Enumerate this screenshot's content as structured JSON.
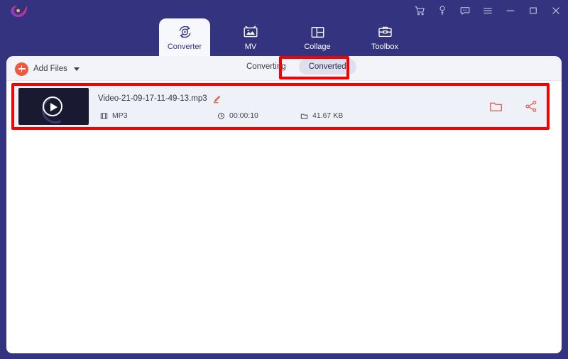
{
  "window": {
    "logo_name": "video-converter-logo",
    "background_color": "#343380",
    "controls": [
      {
        "name": "cart-icon",
        "label": "Cart"
      },
      {
        "name": "key-icon",
        "label": "Register"
      },
      {
        "name": "feedback-icon",
        "label": "Feedback"
      },
      {
        "name": "menu-icon",
        "label": "Menu"
      },
      {
        "name": "minimize-icon",
        "label": "Minimize"
      },
      {
        "name": "maximize-icon",
        "label": "Maximize"
      },
      {
        "name": "close-icon",
        "label": "Close"
      }
    ]
  },
  "tabs": [
    {
      "id": "converter",
      "label": "Converter",
      "icon": "converter-icon",
      "active": true
    },
    {
      "id": "mv",
      "label": "MV",
      "icon": "mv-icon",
      "active": false
    },
    {
      "id": "collage",
      "label": "Collage",
      "icon": "collage-icon",
      "active": false
    },
    {
      "id": "toolbox",
      "label": "Toolbox",
      "icon": "toolbox-icon",
      "active": false
    }
  ],
  "toolbar": {
    "add_files_label": "Add Files",
    "add_files_icon": "plus-circle-icon",
    "dropdown_icon": "caret-down-icon",
    "segments": [
      {
        "id": "converting",
        "label": "Converting",
        "active": false
      },
      {
        "id": "converted",
        "label": "Converted",
        "active": true
      }
    ]
  },
  "file_row": {
    "thumbnail_icon": "play-button-icon",
    "filename": "Video-21-09-17-11-49-13.mp3",
    "edit_icon": "pencil-edit-icon",
    "meta": {
      "format_icon": "film-icon",
      "format": "MP3",
      "duration_icon": "clock-icon",
      "duration": "00:00:10",
      "size_icon": "folder-small-icon",
      "size": "41.67 KB"
    },
    "actions": [
      {
        "name": "open-folder-icon",
        "label": "Open Folder"
      },
      {
        "name": "share-icon",
        "label": "Share"
      }
    ]
  },
  "annotations": {
    "color": "#f60000",
    "items": [
      {
        "name": "converted-tab-highlight",
        "target": "Converted"
      },
      {
        "name": "converted-file-row-highlight",
        "target": "Video-21-09-17-11-49-13.mp3"
      }
    ]
  }
}
